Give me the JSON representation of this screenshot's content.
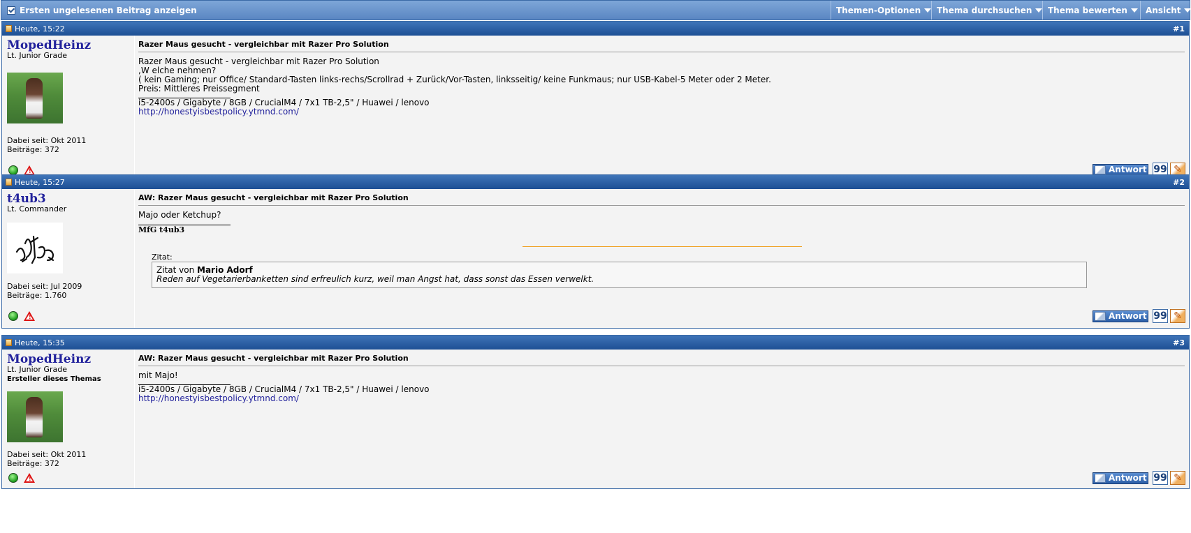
{
  "toolbar": {
    "first_unread": "Ersten ungelesenen Beitrag anzeigen",
    "menus": [
      "Themen-Optionen",
      "Thema durchsuchen",
      "Thema bewerten",
      "Ansicht"
    ]
  },
  "posts": [
    {
      "date": "Heute, 15:22",
      "number": "#1",
      "username": "MopedHeinz",
      "rank": "Lt. Junior Grade",
      "creator": "",
      "joined": "Dabei seit: Okt 2011",
      "posts": "Beiträge: 372",
      "title": "Razer Maus gesucht - vergleichbar mit Razer Pro Solution",
      "lines": [
        "Razer Maus gesucht - vergleichbar mit Razer Pro Solution",
        ",W elche nehmen?",
        "( kein Gaming; nur Office/ Standard-Tasten links-rechs/Scrollrad + Zurück/Vor-Tasten, linksseitig/ keine Funkmaus; nur USB-Kabel-5 Meter oder 2 Meter.",
        "Preis: Mittleres Preissegment"
      ],
      "signature": "i5-2400s / Gigabyte / 8GB / CrucialM4 / 7x1 TB-2,5\" / Huawei / lenovo",
      "signature_link": "http://honestyisbestpolicy.ytmnd.com/"
    },
    {
      "date": "Heute, 15:27",
      "number": "#2",
      "username": "t4ub3",
      "rank": "Lt. Commander",
      "joined": "Dabei seit: Jul 2009",
      "posts": "Beiträge: 1.760",
      "title": "AW: Razer Maus gesucht - vergleichbar mit Razer Pro Solution",
      "lines": [
        "Majo oder Ketchup?"
      ],
      "signature": "MfG t4ub3",
      "quote_label": "Zitat:",
      "quote_prefix": "Zitat von ",
      "quote_author": "Mario Adorf",
      "quote_text": "Reden auf Vegetarierbanketten sind erfreulich kurz, weil man Angst hat, dass sonst das Essen verwelkt."
    },
    {
      "date": "Heute, 15:35",
      "number": "#3",
      "username": "MopedHeinz",
      "rank": "Lt. Junior Grade",
      "creator": "Ersteller dieses Themas",
      "joined": "Dabei seit: Okt 2011",
      "posts": "Beiträge: 372",
      "title": "AW: Razer Maus gesucht - vergleichbar mit Razer Pro Solution",
      "lines": [
        "mit Majo!"
      ],
      "signature": "i5-2400s / Gigabyte / 8GB / CrucialM4 / 7x1 TB-2,5\" / Huawei / lenovo",
      "signature_link": "http://honestyisbestpolicy.ytmnd.com/"
    }
  ],
  "buttons": {
    "reply": "Antwort",
    "quote_symbol": "99",
    "edit_symbol": "✎"
  },
  "colors": {
    "header_blue": "#1d4f94",
    "username": "#22229c",
    "post_bg": "#f3f3f3",
    "quote_rule": "#f0a020"
  }
}
